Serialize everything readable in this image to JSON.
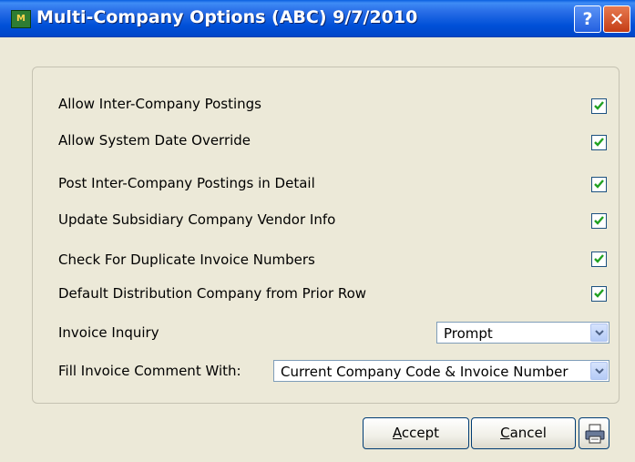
{
  "window": {
    "title": "Multi-Company Options (ABC) 9/7/2010",
    "help_label": "?",
    "close_label": "✕",
    "icon_label": "M"
  },
  "options": [
    {
      "label": "Allow Inter-Company Postings",
      "checked": true
    },
    {
      "label": "Allow System Date Override",
      "checked": true
    },
    {
      "label": "Post Inter-Company Postings in Detail",
      "checked": true
    },
    {
      "label": "Update Subsidiary Company Vendor Info",
      "checked": true
    },
    {
      "label": "Check For Duplicate Invoice Numbers",
      "checked": true
    },
    {
      "label": "Default Distribution Company from Prior Row",
      "checked": true
    }
  ],
  "invoice_inquiry": {
    "label": "Invoice Inquiry",
    "value": "Prompt"
  },
  "fill_comment": {
    "label": "Fill Invoice Comment With:",
    "value": "Current Company Code & Invoice Number"
  },
  "buttons": {
    "accept_prefix": "A",
    "accept_rest": "ccept",
    "cancel_prefix": "C",
    "cancel_rest": "ancel"
  },
  "colors": {
    "titlebar": "#0050d8",
    "check": "#21a121",
    "face": "#ece9d8"
  }
}
